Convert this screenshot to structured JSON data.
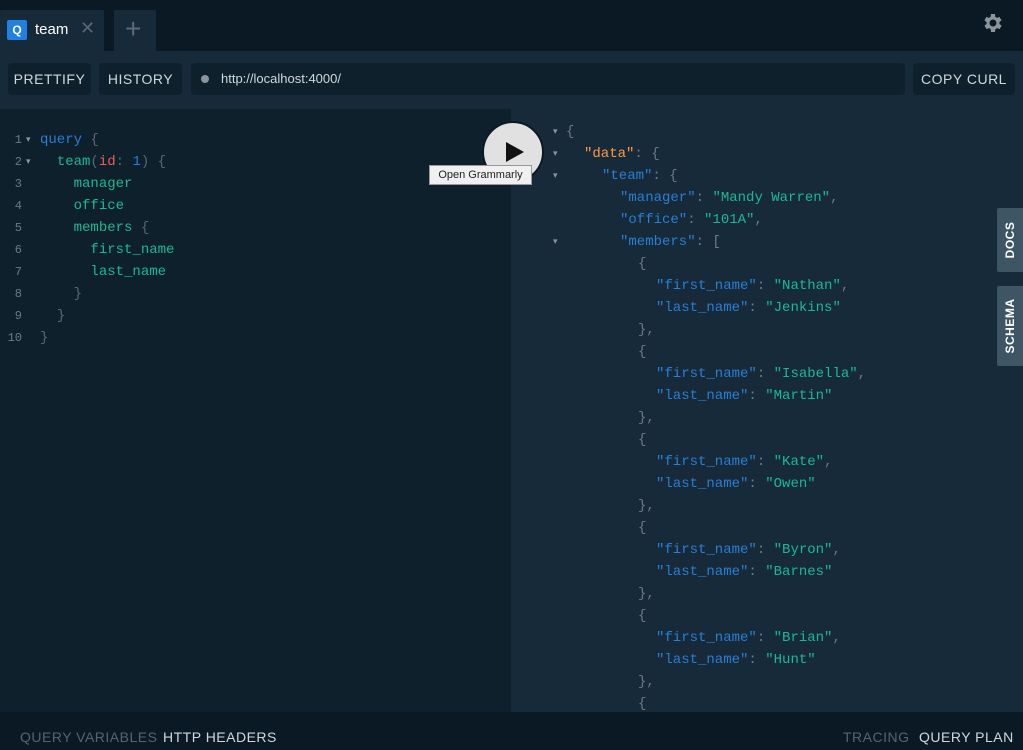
{
  "tabs": [
    {
      "badge": "Q",
      "label": "team",
      "close": "✕"
    }
  ],
  "new_tab_glyph": "+",
  "icons": {
    "settings": "gear-icon",
    "run": "play-icon",
    "close": "close-icon",
    "add": "plus-icon"
  },
  "toolbar": {
    "prettify": "PRETTIFY",
    "history": "HISTORY",
    "url": "http://localhost:4000/",
    "copy_curl": "COPY CURL"
  },
  "editor": {
    "lines": [
      {
        "n": "1",
        "fold": "▾"
      },
      {
        "n": "2",
        "fold": "▾"
      },
      {
        "n": "3"
      },
      {
        "n": "4"
      },
      {
        "n": "5"
      },
      {
        "n": "6"
      },
      {
        "n": "7"
      },
      {
        "n": "8"
      },
      {
        "n": "9"
      },
      {
        "n": "10"
      }
    ],
    "tokens": {
      "query": "query",
      "team": "team",
      "id_arg": "id",
      "id_val": "1",
      "manager": "manager",
      "office": "office",
      "members": "members",
      "first_name": "first_name",
      "last_name": "last_name"
    }
  },
  "run": {
    "tooltip": "Open Grammarly"
  },
  "result": {
    "data_key": "\"data\"",
    "team_key": "\"team\"",
    "manager_key": "\"manager\"",
    "manager_val": "\"Mandy Warren\"",
    "office_key": "\"office\"",
    "office_val": "\"101A\"",
    "members_key": "\"members\"",
    "first_key": "\"first_name\"",
    "last_key": "\"last_name\"",
    "members": [
      {
        "first": "\"Nathan\"",
        "last": "\"Jenkins\""
      },
      {
        "first": "\"Isabella\"",
        "last": "\"Martin\""
      },
      {
        "first": "\"Kate\"",
        "last": "\"Owen\""
      },
      {
        "first": "\"Byron\"",
        "last": "\"Barnes\""
      },
      {
        "first": "\"Brian\"",
        "last": "\"Hunt\""
      }
    ]
  },
  "side_tabs": {
    "docs": "DOCS",
    "schema": "SCHEMA"
  },
  "footer": {
    "query_variables": "QUERY VARIABLES",
    "http_headers": "HTTP HEADERS",
    "tracing": "TRACING",
    "query_plan": "QUERY PLAN"
  }
}
